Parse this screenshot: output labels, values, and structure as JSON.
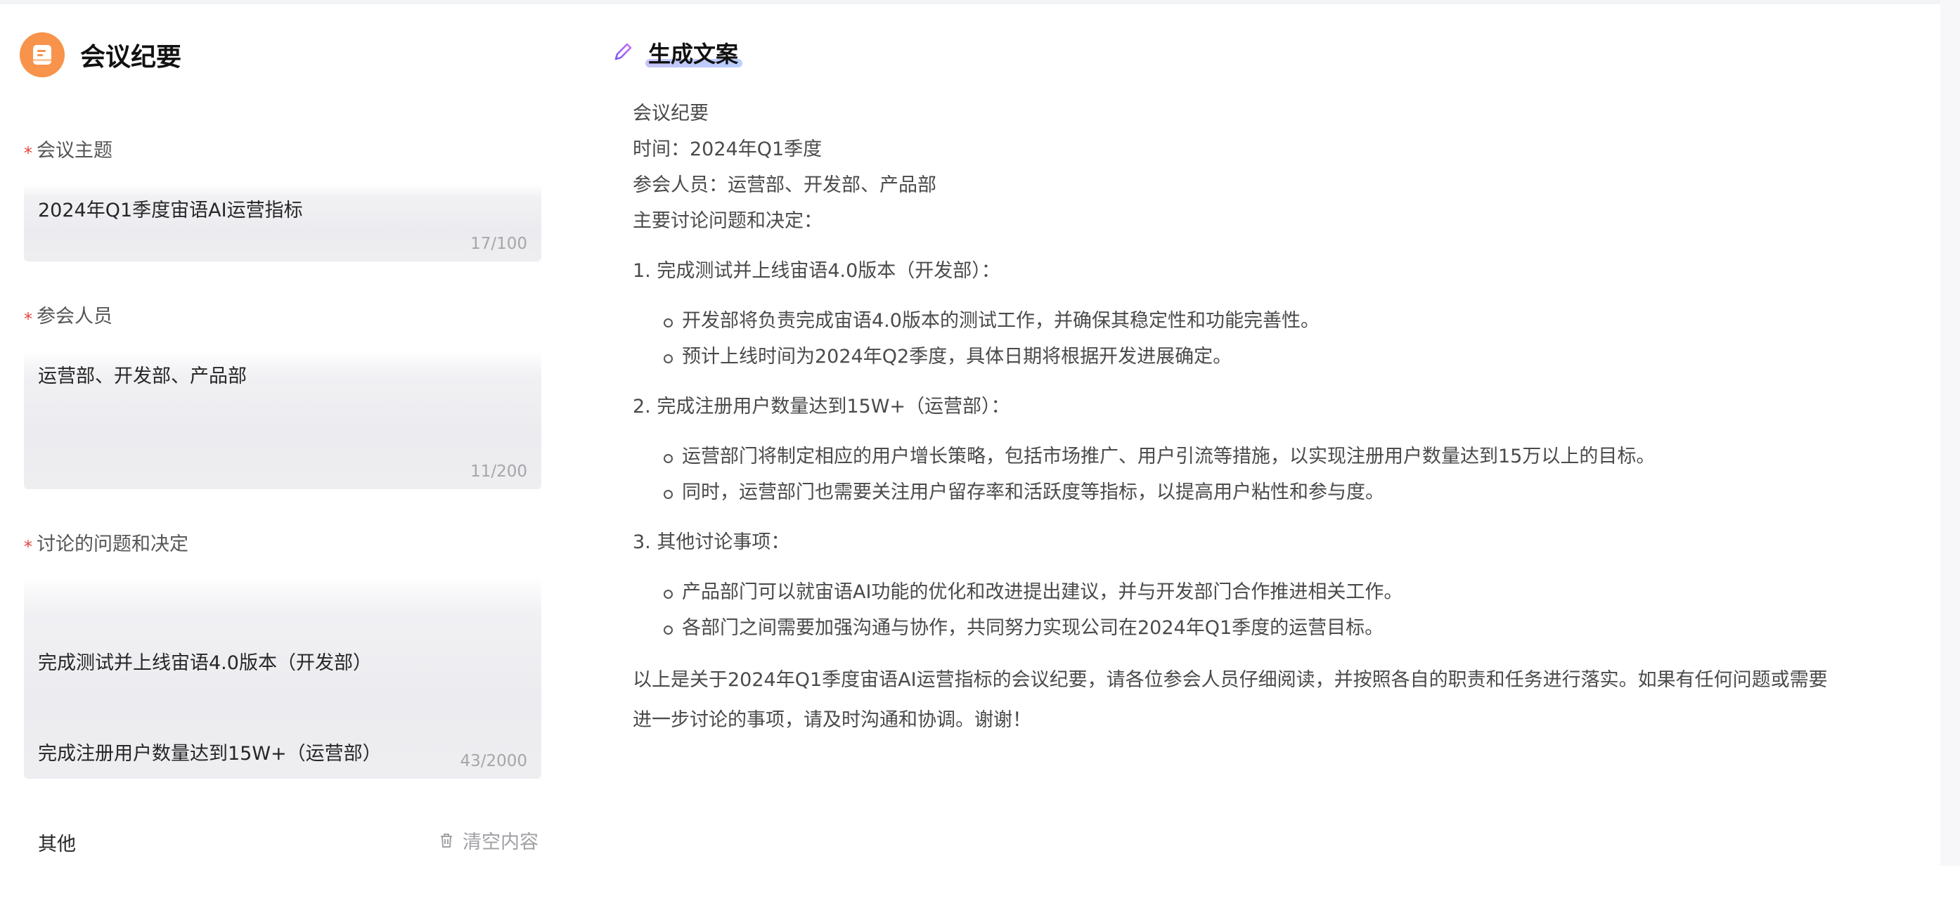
{
  "app": {
    "title": "会议纪要",
    "icon": "notebook-icon",
    "icon_color": "#f7934a"
  },
  "form": {
    "topic": {
      "label": "会议主题",
      "value": "2024年Q1季度宙语AI运营指标",
      "count": "17/100"
    },
    "participants": {
      "label": "参会人员",
      "value": "运营部、开发部、产品部",
      "count": "11/200"
    },
    "issues": {
      "label": "讨论的问题和决定",
      "lines": [
        "完成测试并上线宙语4.0版本（开发部）",
        "完成注册用户数量达到15W+（运营部）",
        "其他"
      ],
      "count": "43/2000"
    },
    "clear_label": "清空内容",
    "required_color": "#e5433c"
  },
  "output": {
    "title": "生成文案",
    "icon": "pencil-icon",
    "header_lines": [
      "会议纪要",
      "时间：2024年Q1季度",
      "参会人员：运营部、开发部、产品部",
      "主要讨论问题和决定："
    ],
    "sections": [
      {
        "heading": "1. 完成测试并上线宙语4.0版本（开发部）：",
        "bullets": [
          "开发部将负责完成宙语4.0版本的测试工作，并确保其稳定性和功能完善性。",
          "预计上线时间为2024年Q2季度，具体日期将根据开发进展确定。"
        ]
      },
      {
        "heading": "2. 完成注册用户数量达到15W+（运营部）：",
        "bullets": [
          "运营部门将制定相应的用户增长策略，包括市场推广、用户引流等措施，以实现注册用户数量达到15万以上的目标。",
          "同时，运营部门也需要关注用户留存率和活跃度等指标，以提高用户粘性和参与度。"
        ]
      },
      {
        "heading": "3. 其他讨论事项：",
        "bullets": [
          "产品部门可以就宙语AI功能的优化和改进提出建议，并与开发部门合作推进相关工作。",
          "各部门之间需要加强沟通与协作，共同努力实现公司在2024年Q1季度的运营目标。"
        ]
      }
    ],
    "closing_lines": [
      "以上是关于2024年Q1季度宙语AI运营指标的会议纪要，请各位参会人员仔细阅读，并按照各自的职责和任务进行落实。如果有任何问题或需要",
      "进一步讨论的事项，请及时沟通和协调。谢谢！"
    ]
  }
}
